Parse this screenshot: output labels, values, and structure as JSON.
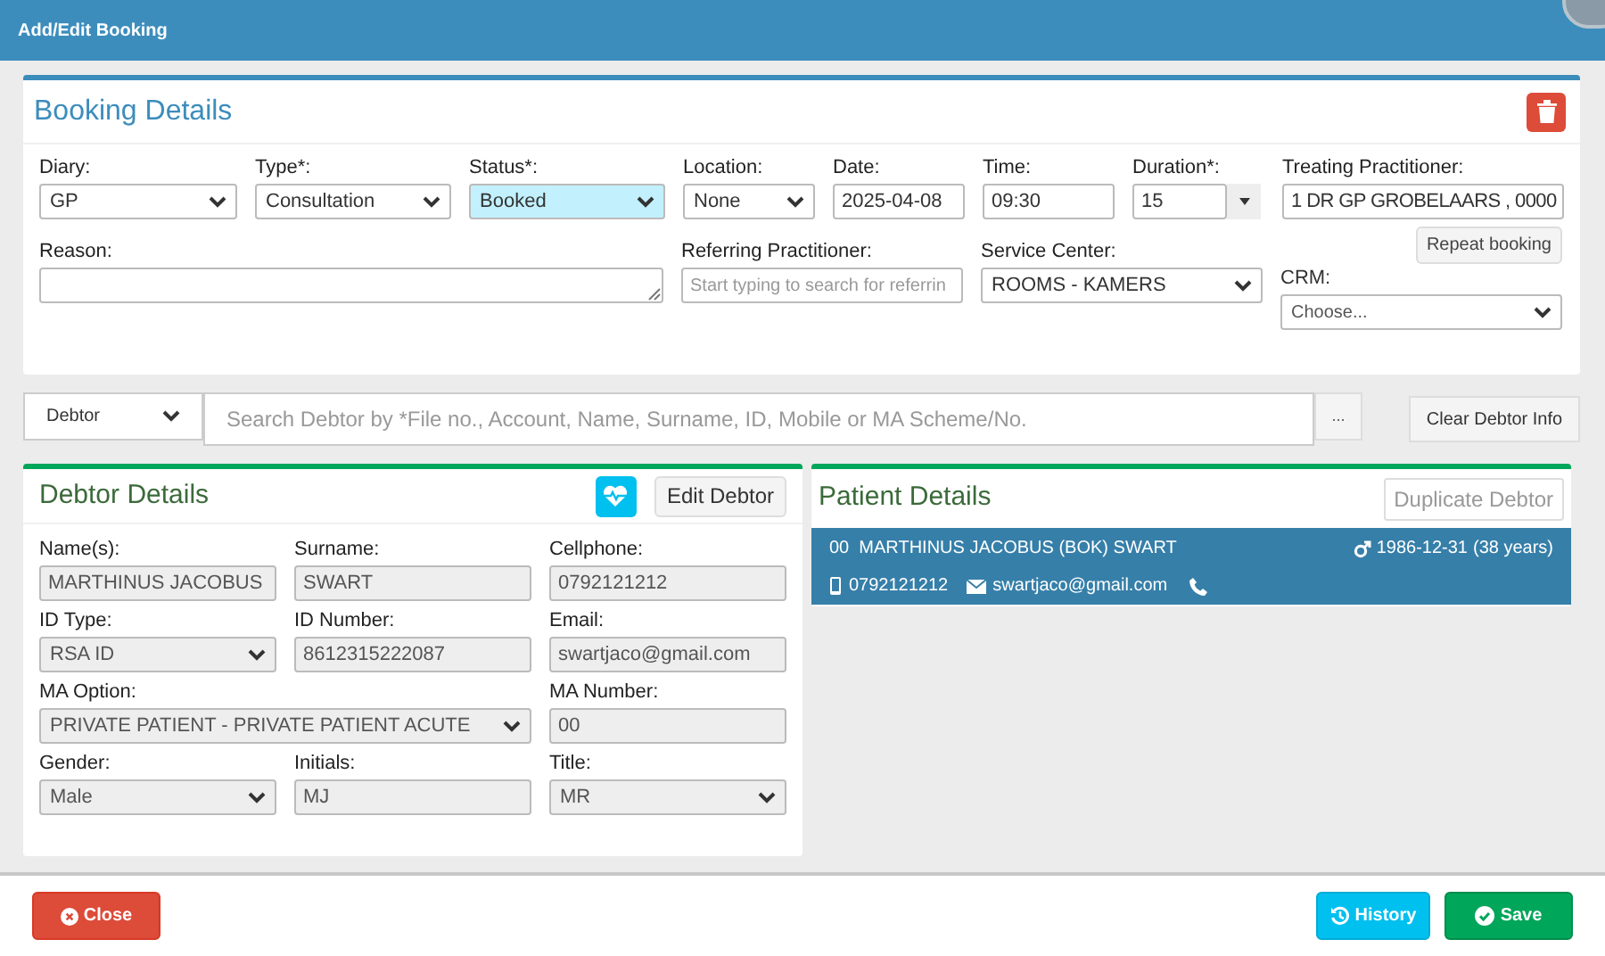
{
  "window": {
    "title": "Add/Edit Booking"
  },
  "booking": {
    "title": "Booking Details",
    "row_1": [
      {
        "label": "Diary:",
        "kind": "select",
        "value": "GP",
        "highlighted": false
      },
      {
        "label": "Type*:",
        "kind": "select",
        "value": "Consultation",
        "highlighted": false
      },
      {
        "label": "Status*:",
        "kind": "select",
        "value": "Booked",
        "highlighted": true
      },
      {
        "label": "Location:",
        "kind": "select",
        "value": "None",
        "highlighted": false
      },
      {
        "label": "Date:",
        "kind": "input",
        "value": "2025-04-08",
        "highlighted": false
      },
      {
        "label": "Time:",
        "kind": "input",
        "value": "09:30",
        "highlighted": false
      },
      {
        "label": "Duration*:",
        "kind": "combo",
        "value": "15",
        "highlighted": false
      },
      {
        "label": "Treating Practitioner:",
        "kind": "input",
        "value": "1 DR GP GROBELAARS , 0000",
        "highlighted": false
      }
    ],
    "row_2": [
      {
        "label": "Reason:",
        "kind": "textarea",
        "highlighted": false
      },
      {
        "label": "Referring Practitioner:",
        "kind": "input",
        "placeholder": "Start typing to search for referrin",
        "highlighted": false
      },
      {
        "label": "Service Center:",
        "kind": "select",
        "value": "ROOMS - KAMERS",
        "highlighted": false
      }
    ],
    "repeat_button": "Repeat booking",
    "crm": {
      "label": "CRM:",
      "value": "Choose..."
    }
  },
  "search": {
    "type": "Debtor",
    "placeholder": "Search Debtor by *File no., Account, Name, Surname, ID, Mobile or MA Scheme/No.",
    "more": "...",
    "clear": "Clear Debtor Info"
  },
  "debtor": {
    "title": "Debtor Details",
    "edit": "Edit Debtor",
    "fields": [
      {
        "label": "Name(s):",
        "kind": "input",
        "value": "MARTHINUS JACOBUS"
      },
      {
        "label": "Surname:",
        "kind": "input",
        "value": "SWART"
      },
      {
        "label": "Cellphone:",
        "kind": "input",
        "value": "0792121212"
      },
      {
        "label": "ID Type:",
        "kind": "select",
        "value": "RSA ID"
      },
      {
        "label": "ID Number:",
        "kind": "input",
        "value": "8612315222087"
      },
      {
        "label": "Email:",
        "kind": "input",
        "value": "swartjaco@gmail.com"
      },
      {
        "label": "MA Option:",
        "kind": "wide_select",
        "value": "PRIVATE PATIENT - PRIVATE PATIENT ACUTE"
      },
      {
        "label": "MA Number:",
        "kind": "input",
        "value": "00"
      },
      {
        "label": "Gender:",
        "kind": "select",
        "value": "Male"
      },
      {
        "label": "Initials:",
        "kind": "input",
        "value": "MJ"
      },
      {
        "label": "Title:",
        "kind": "select",
        "value": "MR"
      }
    ]
  },
  "patient": {
    "title": "Patient Details",
    "duplicate": "Duplicate Debtor",
    "card": {
      "name": "00  MARTHINUS JACOBUS (BOK) SWART",
      "birth_date": "1986-12-31",
      "age": "(38 years)",
      "mobile": "0792121212",
      "email": "swartjaco@gmail.com"
    }
  },
  "footer": {
    "close": "Close",
    "history": "History",
    "save": "Save"
  }
}
